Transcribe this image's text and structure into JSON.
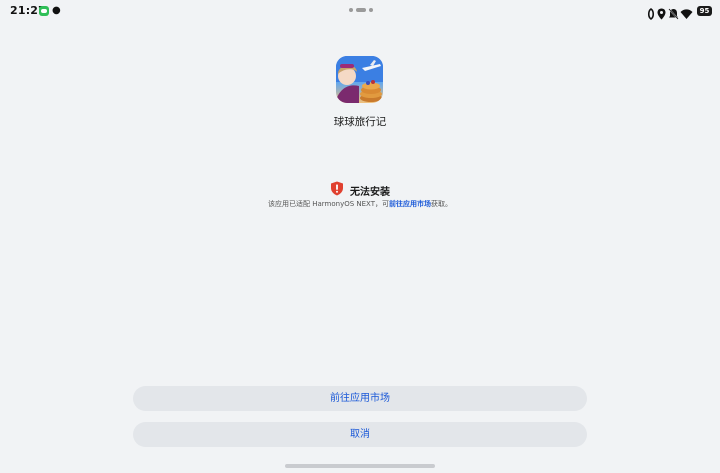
{
  "status_bar": {
    "time": "21:27",
    "battery_level": "95",
    "left_icons": [
      "chat-icon",
      "penguin-icon"
    ],
    "right_icons": [
      "nfc-icon",
      "location-icon",
      "mute-bell-icon",
      "wifi-icon",
      "battery-icon"
    ]
  },
  "app": {
    "name": "球球旅行记",
    "icon": "app-icon"
  },
  "notice": {
    "icon": "warning-shield-icon",
    "icon_color": "#e0402f",
    "title": "无法安装",
    "desc_prefix": "该应用已适配 HarmonyOS NEXT，可",
    "desc_link": "前往应用市场",
    "desc_suffix": "获取。"
  },
  "buttons": {
    "go_market": "前往应用市场",
    "cancel": "取消"
  },
  "colors": {
    "background": "#f1f3f5",
    "button_bg": "#e3e6ea",
    "accent": "#1a58d8",
    "warning": "#e0402f"
  }
}
